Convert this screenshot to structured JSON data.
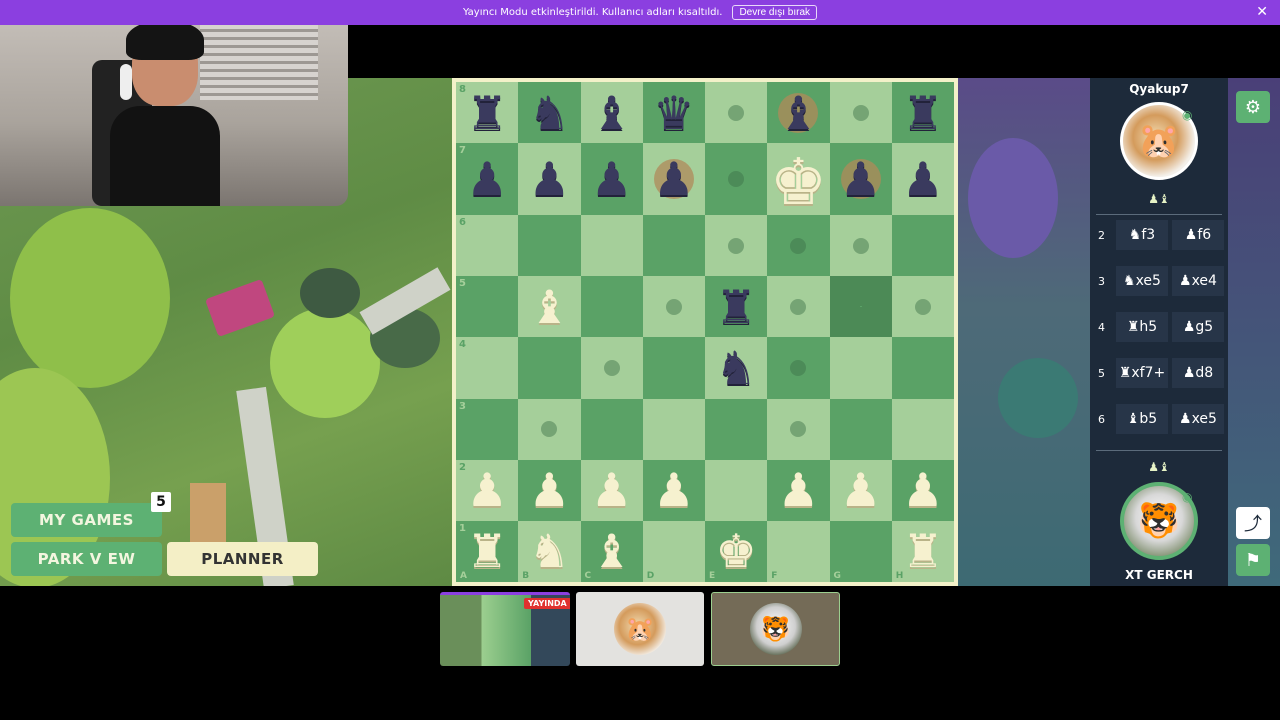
{
  "banner": {
    "text": "Yayıncı Modu etkinleştirildi. Kullanıcı adları kısaltıldı.",
    "button_label": "Devre dışı bırak",
    "close_icon": "✕"
  },
  "left_menu": {
    "my_games_label": "MY GAMES",
    "my_games_count": "5",
    "park_view_label": "PARK V EW",
    "planner_label": "PLANNER"
  },
  "board": {
    "ranks": [
      "8",
      "7",
      "6",
      "5",
      "4",
      "3",
      "2",
      "1"
    ],
    "files": [
      "A",
      "B",
      "C",
      "D",
      "E",
      "F",
      "G",
      "H"
    ],
    "rows": [
      [
        "r",
        "n",
        "b",
        "q",
        ".",
        "b",
        ".",
        "r"
      ],
      [
        "p",
        "p",
        "p",
        "p",
        ".",
        "K",
        "p",
        "p"
      ],
      [
        ".",
        ".",
        ".",
        ".",
        ".",
        ".",
        ".",
        "."
      ],
      [
        ".",
        "B",
        ".",
        ".",
        "r",
        ".",
        ".",
        "."
      ],
      [
        ".",
        ".",
        ".",
        ".",
        "n",
        ".",
        ".",
        "."
      ],
      [
        ".",
        ".",
        ".",
        ".",
        ".",
        ".",
        ".",
        "."
      ],
      [
        "P",
        "P",
        "P",
        "P",
        ".",
        "P",
        "P",
        "P"
      ],
      [
        "R",
        "N",
        "B",
        ".",
        "K",
        ".",
        ".",
        "R"
      ]
    ],
    "dots": [
      [
        0,
        4
      ],
      [
        0,
        6
      ],
      [
        1,
        4
      ],
      [
        2,
        4
      ],
      [
        2,
        5
      ],
      [
        2,
        6
      ],
      [
        3,
        3
      ],
      [
        3,
        5
      ],
      [
        3,
        7
      ],
      [
        4,
        2
      ],
      [
        4,
        5
      ],
      [
        5,
        1
      ],
      [
        5,
        5
      ]
    ],
    "rings": [
      [
        0,
        5
      ],
      [
        1,
        3
      ],
      [
        1,
        6
      ]
    ],
    "highlight": [
      [
        3,
        6
      ]
    ]
  },
  "opponent": {
    "name": "Qyakup7",
    "captured": "♟♝"
  },
  "player": {
    "name": "XT GERCH",
    "captured": "♟♝"
  },
  "moves": [
    {
      "num": "2",
      "white": "♞f3",
      "black": "♟f6"
    },
    {
      "num": "3",
      "white": "♞xe5",
      "black": "♟xe4"
    },
    {
      "num": "4",
      "white": "♜h5",
      "black": "♟g5"
    },
    {
      "num": "5",
      "white": "♜xf7+",
      "black": "♟d8"
    },
    {
      "num": "6",
      "white": "♝b5",
      "black": "♟xe5"
    }
  ],
  "thumbs": {
    "live_label": "YAYINDA"
  },
  "icons": {
    "settings": "⚙",
    "share": "⤴",
    "flag": "⚑",
    "eye": "◉",
    "hamster": "🐹",
    "tiger": "🐯"
  }
}
